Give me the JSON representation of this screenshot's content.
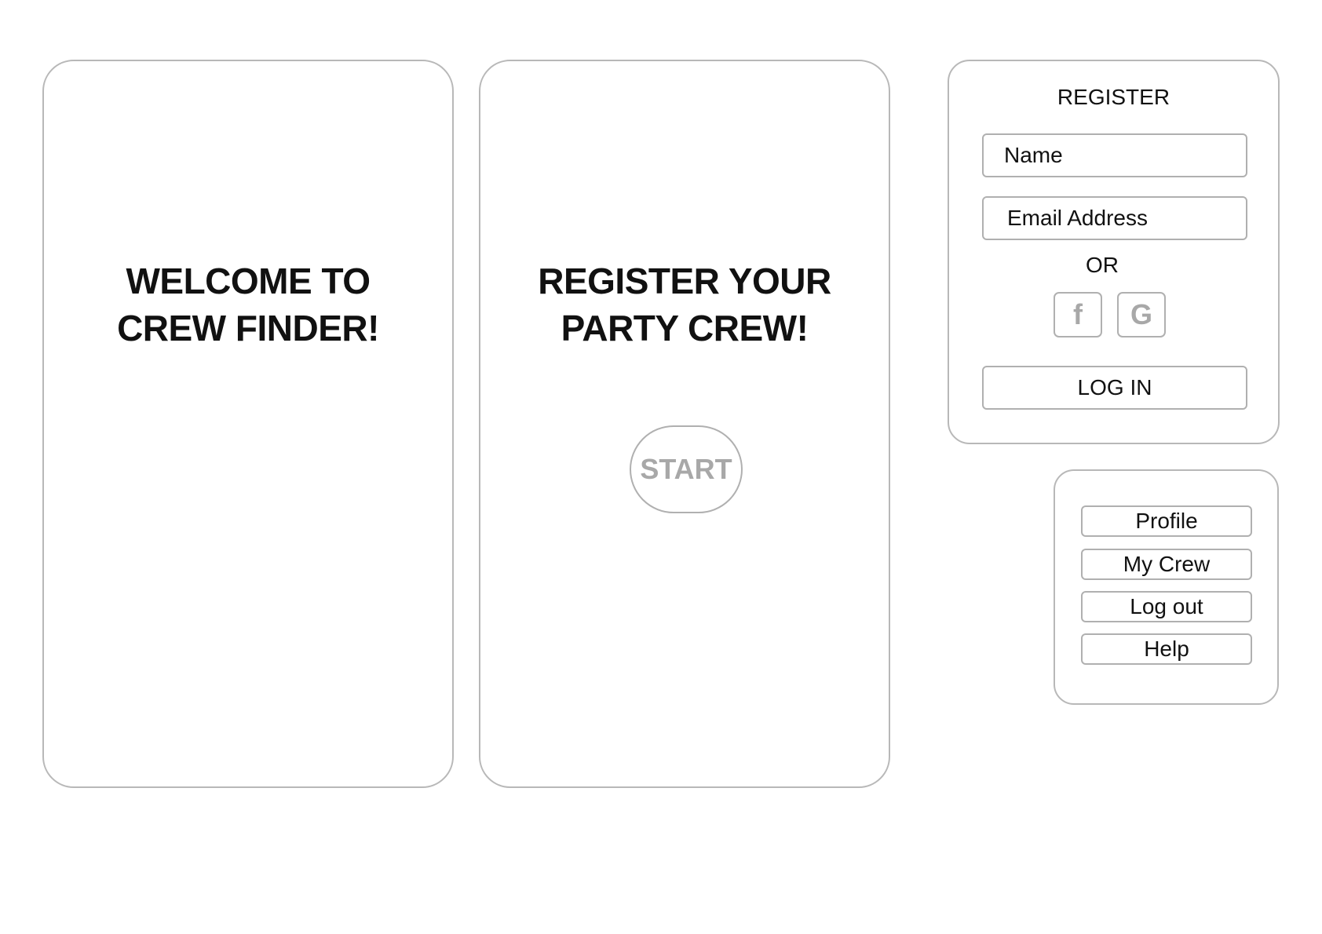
{
  "welcome_screen": {
    "headline_line1": "WELCOME TO",
    "headline_line2": "CREW FINDER!"
  },
  "register_intro_screen": {
    "headline_line1": "REGISTER YOUR",
    "headline_line2": "PARTY CREW!",
    "start_label": "START"
  },
  "register_panel": {
    "title": "REGISTER",
    "name_placeholder": "Name",
    "email_placeholder": "Email Address",
    "or_label": "OR",
    "social": [
      {
        "label": "f",
        "icon": "facebook-icon"
      },
      {
        "label": "G",
        "icon": "google-icon"
      }
    ],
    "login_label": "LOG IN"
  },
  "menu_panel": {
    "items": [
      {
        "label": "Profile"
      },
      {
        "label": "My Crew"
      },
      {
        "label": "Log out"
      },
      {
        "label": "Help"
      }
    ]
  },
  "colors": {
    "border": "#b8b8b8",
    "text": "#111111",
    "muted": "#a8a8a8",
    "background": "#ffffff"
  }
}
